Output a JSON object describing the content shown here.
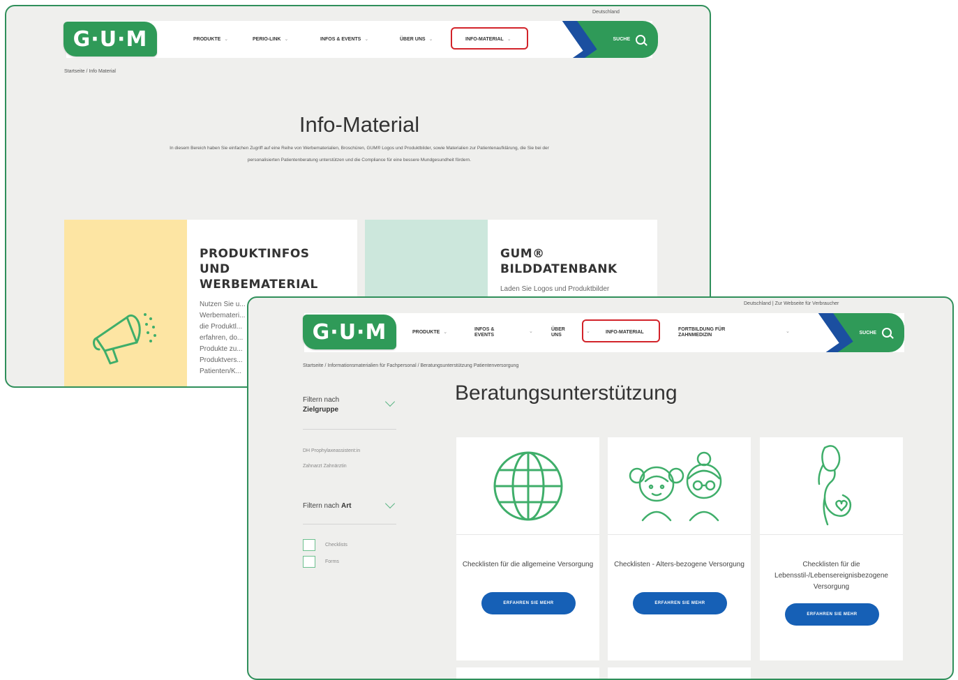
{
  "screen1": {
    "country": "Deutschland",
    "logo": "G·U·M",
    "nav": [
      {
        "label": "PRODUKTE"
      },
      {
        "label": "PERIO-LINK"
      },
      {
        "label": "INFOS & EVENTS"
      },
      {
        "label": "ÜBER UNS"
      },
      {
        "label": "INFO-MATERIAL"
      }
    ],
    "search_label": "SUCHE",
    "breadcrumb": "Startseite / Info Material",
    "title": "Info-Material",
    "intro": "In diesem Bereich haben Sie einfachen Zugriff auf eine Reihe von Werbematerialien, Broschüren, GUM® Logos und Produktbilder, sowie Materialien zur Patientenaufklärung, die Sie bei der personalisierten Patientenberatung unterstützen und die Compliance für eine bessere Mundgesundheit fördern.",
    "cards": [
      {
        "title": "PRODUKTINFOS\nUND\nWERBEMATERIAL",
        "text": "Nutzen Sie u...\nWerbemateri...\ndie Produktl...\nerfahren, do...\nProdukte zu...\nProduktvers...\nPatienten/K..."
      },
      {
        "title": "GUM®\nBILDDATENBANK",
        "text": "Laden Sie Logos und Produktbilder"
      }
    ],
    "colors": {
      "frame": "#2f8f5a",
      "brand": "#2f9a58",
      "highlight": "#d2232a",
      "card1": "#fde5a3",
      "card2": "#cce7dc"
    }
  },
  "screen2": {
    "top_links": "Deutschland | Zur Webseite für Verbraucher",
    "logo": "G·U·M",
    "nav": [
      {
        "label": "PRODUKTE"
      },
      {
        "label": "INFOS & EVENTS"
      },
      {
        "label": "ÜBER UNS"
      },
      {
        "label": "INFO-MATERIAL"
      },
      {
        "label": "FORTBILDUNG FÜR ZAHNMEDIZIN"
      }
    ],
    "search_label": "SUCHE",
    "breadcrumb": "Startseite / Informationsmaterialien für Fachpersonal / Beratungsunterstützung Patientenversorgung",
    "title": "Beratungsunterstützung",
    "filter_group": {
      "label": "Filtern nach",
      "value": "Zielgruppe",
      "options": [
        "DH Prophylaxeassistent:in",
        "Zahnarzt Zahnärztin"
      ]
    },
    "filter_type": {
      "label": "Filtern nach",
      "value": "Art",
      "options": [
        "Checklists",
        "Forms"
      ]
    },
    "cards": [
      {
        "label": "Checklisten für die allgemeine Versorgung",
        "button": "ERFAHREN SIE MEHR",
        "icon": "globe-icon"
      },
      {
        "label": "Checklisten - Alters-bezogene Versorgung",
        "button": "ERFAHREN SIE MEHR",
        "icon": "children-icon"
      },
      {
        "label": "Checklisten für die Lebensstil-/Lebensereignisbezogene Versorgung",
        "button": "ERFAHREN SIE MEHR",
        "icon": "pregnant-woman-icon"
      }
    ],
    "colors": {
      "button": "#1660b6",
      "icon": "#3fae6a"
    }
  }
}
